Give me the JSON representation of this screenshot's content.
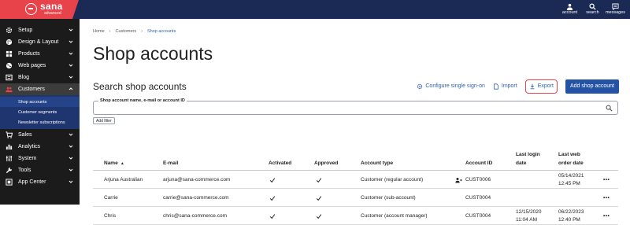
{
  "brand": {
    "name": "sana",
    "sub": "advanced"
  },
  "topnav": [
    {
      "label": "account",
      "icon": "account-icon"
    },
    {
      "label": "search",
      "icon": "search-icon"
    },
    {
      "label": "messages",
      "icon": "messages-icon"
    }
  ],
  "sidebar": {
    "items": [
      {
        "label": "Setup",
        "icon": "gear-icon"
      },
      {
        "label": "Design & Layout",
        "icon": "palette-icon"
      },
      {
        "label": "Products",
        "icon": "products-icon"
      },
      {
        "label": "Web pages",
        "icon": "globe-icon"
      },
      {
        "label": "Blog",
        "icon": "blog-icon"
      },
      {
        "label": "Customers",
        "icon": "users-icon",
        "active": true
      },
      {
        "label": "Sales",
        "icon": "cart-icon"
      },
      {
        "label": "Analytics",
        "icon": "analytics-icon"
      },
      {
        "label": "System",
        "icon": "system-icon"
      },
      {
        "label": "Tools",
        "icon": "tools-icon"
      },
      {
        "label": "App Center",
        "icon": "app-center-icon"
      }
    ],
    "subitems": [
      "Shop accounts",
      "Customer segments",
      "Newsletter subscriptions"
    ]
  },
  "breadcrumb": [
    "Home",
    "Customers",
    "Shop accounts"
  ],
  "page_title": "Shop accounts",
  "search_heading": "Search shop accounts",
  "actions": {
    "sso": "Configure single sign-on",
    "import": "Import",
    "export": "Export",
    "add": "Add shop account"
  },
  "search": {
    "label": "Shop account name, e-mail or account ID",
    "value": ""
  },
  "add_filter": "Add filter",
  "table": {
    "headers": {
      "name": "Name",
      "email": "E-mail",
      "activated": "Activated",
      "approved": "Approved",
      "type": "Account type",
      "account_id": "Account ID",
      "last_login": [
        "Last login",
        "date"
      ],
      "last_order": [
        "Last web",
        "order date"
      ]
    },
    "rows": [
      {
        "name": "Arjuna Australian",
        "email": "arjuna@sana-commerce.com",
        "type": "Customer (regular account)",
        "account_id": "CUST0006",
        "last_login": [
          "",
          ""
        ],
        "last_order": [
          "05/14/2021",
          "12:45 PM"
        ],
        "impersonate": true
      },
      {
        "name": "Carrie",
        "email": "carrie@sana-commerce.com",
        "type": "Customer (sub-account)",
        "account_id": "CUST0004",
        "last_login": [
          "",
          ""
        ],
        "last_order": [
          "",
          ""
        ],
        "impersonate": false
      },
      {
        "name": "Chris",
        "email": "chris@sana-commerce.com",
        "type": "Customer (account manager)",
        "account_id": "CUST0004",
        "last_login": [
          "12/15/2020",
          "11:04 AM"
        ],
        "last_order": [
          "06/22/2023",
          "12:40 PM"
        ],
        "impersonate": false
      }
    ],
    "more": "•••"
  },
  "colors": {
    "topbar": "#1b2a55",
    "brand": "#e8424a",
    "sidebar": "#1b1b1b",
    "primary": "#2453a5",
    "link": "#2d63b6"
  }
}
